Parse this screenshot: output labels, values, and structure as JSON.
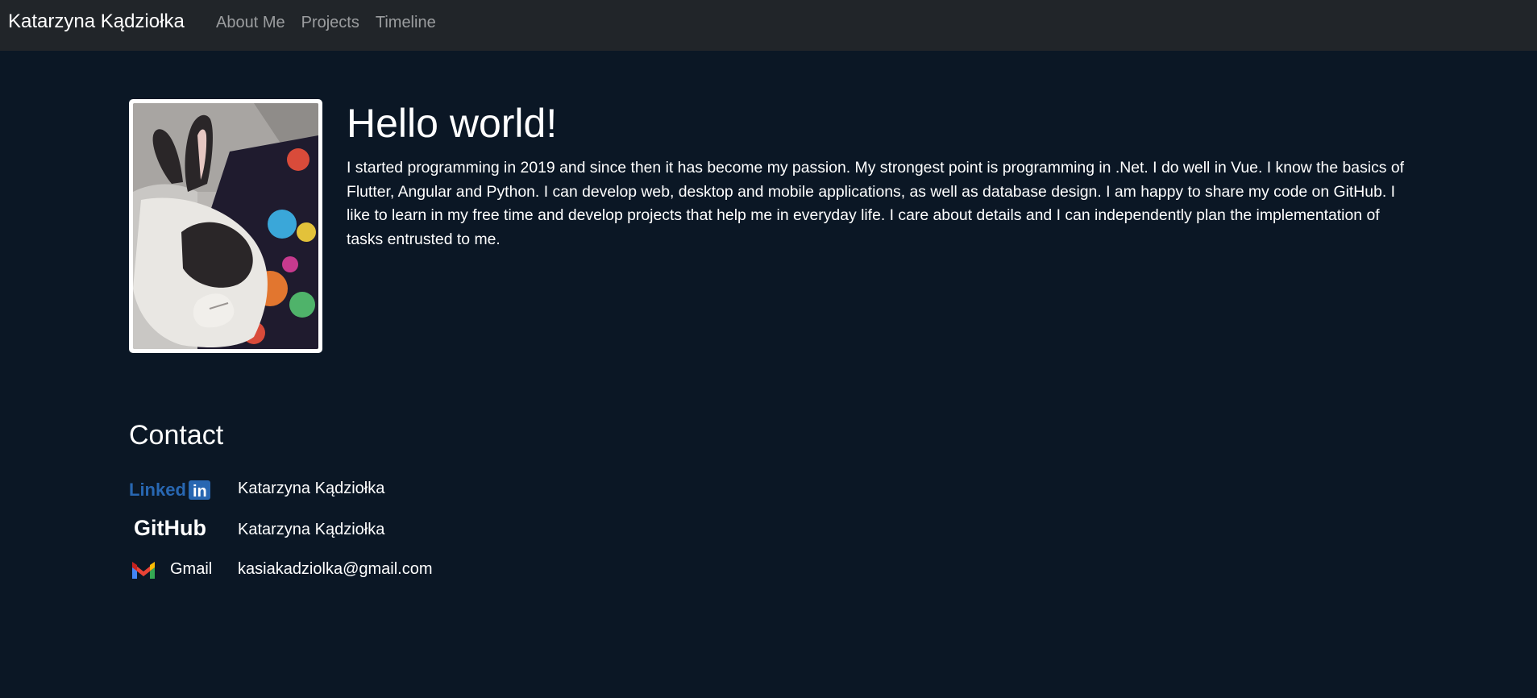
{
  "navbar": {
    "brand": "Katarzyna Kądziołka",
    "links": [
      {
        "label": "About Me"
      },
      {
        "label": "Projects"
      },
      {
        "label": "Timeline"
      }
    ]
  },
  "hero": {
    "title": "Hello world!",
    "bio": "I started programming in 2019 and since then it has become my passion. My strongest point is programming in .Net. I do well in Vue. I know the basics of Flutter, Angular and Python. I can develop web, desktop and mobile applications, as well as database design. I am happy to share my code on GitHub. I like to learn in my free time and develop projects that help me in everyday life. I care about details and I can independently plan the implementation of tasks entrusted to me."
  },
  "contact": {
    "title": "Contact",
    "items": [
      {
        "service": "Linkedin",
        "logo_text": "Linked",
        "logo_badge": "in",
        "logo_color": "#2867b2",
        "label": "Katarzyna Kądziołka"
      },
      {
        "service": "GitHub",
        "logo_text": "GitHub",
        "logo_color": "#ffffff",
        "label": "Katarzyna Kądziołka"
      },
      {
        "service": "Gmail",
        "logo_text": "Gmail",
        "logo_color": "#ffffff",
        "label": "kasiakadziolka@gmail.com"
      }
    ]
  }
}
